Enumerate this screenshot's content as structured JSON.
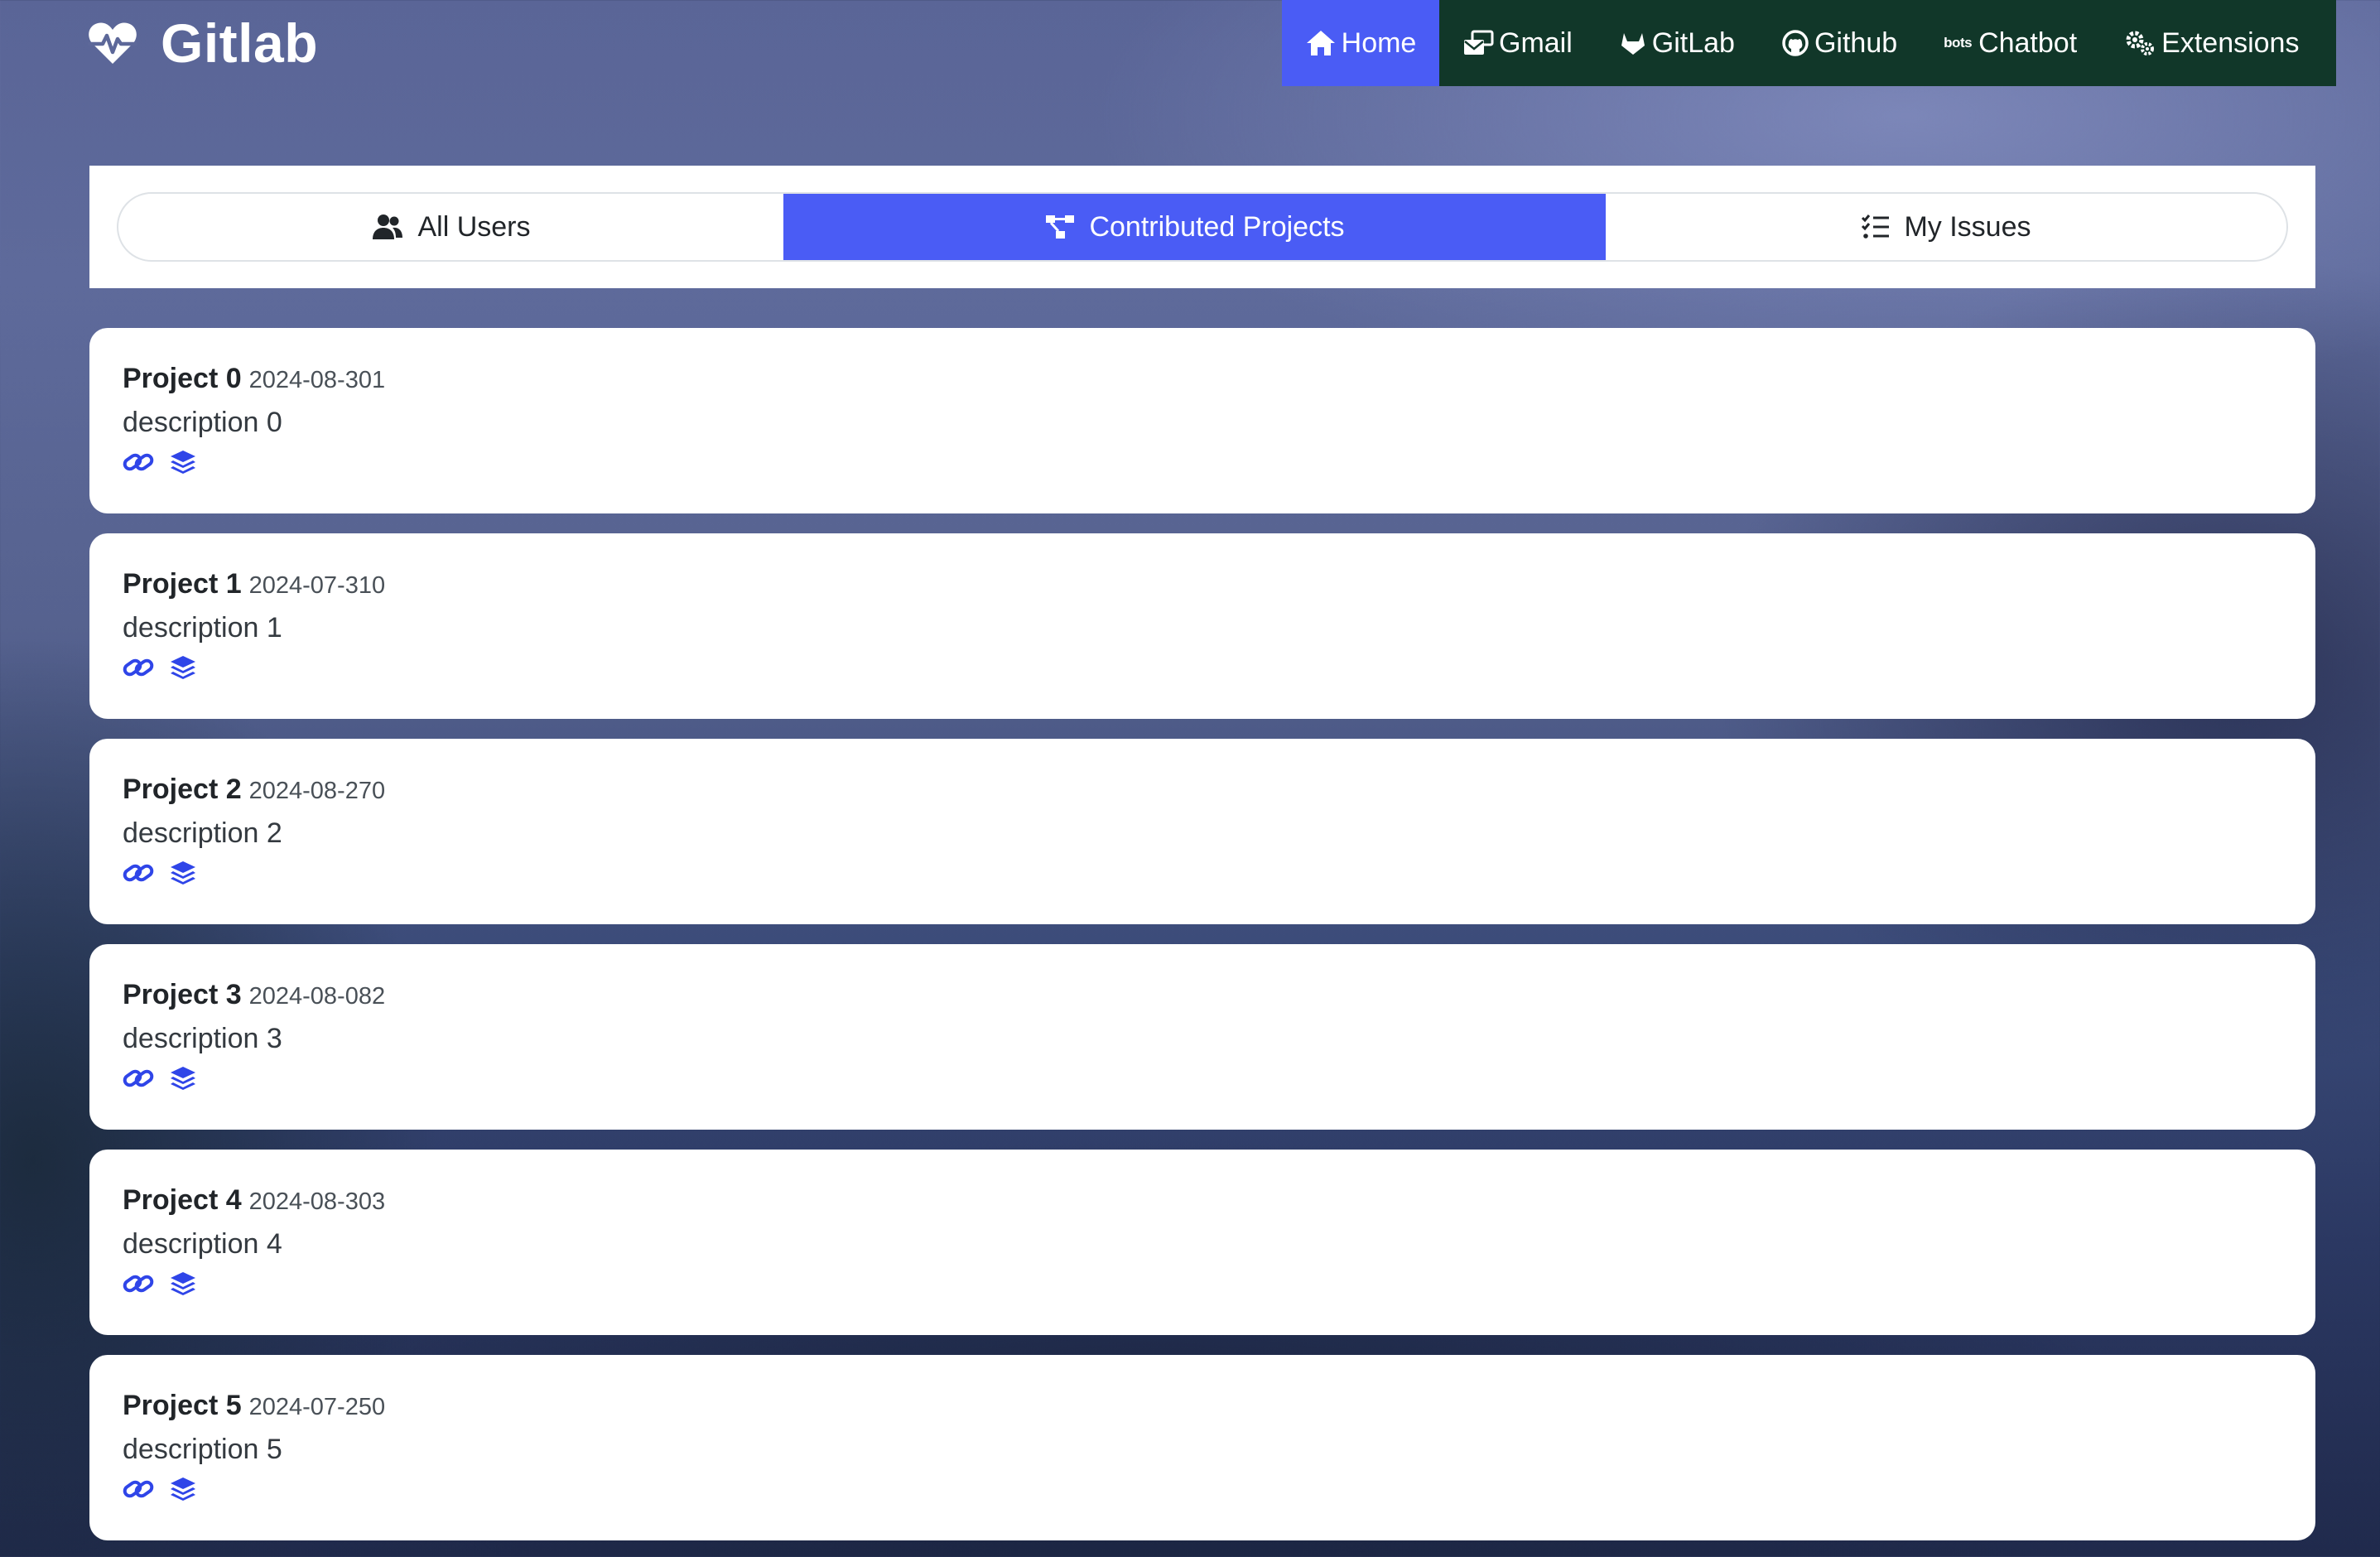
{
  "brand": {
    "title": "Gitlab",
    "icon": "heart-pulse-icon"
  },
  "nav": {
    "items": [
      {
        "label": "Home",
        "icon": "home-icon",
        "active": true
      },
      {
        "label": "Gmail",
        "icon": "mail-stack-icon"
      },
      {
        "label": "GitLab",
        "icon": "gitlab-icon"
      },
      {
        "label": "Github",
        "icon": "github-icon"
      },
      {
        "label": "Chatbot",
        "icon": "bots-icon",
        "glyph": "bots"
      },
      {
        "label": "Extensions",
        "icon": "gears-icon"
      }
    ],
    "colors": {
      "background": "#113729",
      "active": "#4a5cf5"
    }
  },
  "tabs": {
    "items": [
      {
        "label": "All Users",
        "icon": "users-icon"
      },
      {
        "label": "Contributed Projects",
        "icon": "project-diagram-icon",
        "active": true
      },
      {
        "label": "My Issues",
        "icon": "tasks-list-icon"
      }
    ]
  },
  "projects": [
    {
      "title": "Project 0",
      "date": "2024-08-301",
      "description": "description 0"
    },
    {
      "title": "Project 1",
      "date": "2024-07-310",
      "description": "description 1"
    },
    {
      "title": "Project 2",
      "date": "2024-08-270",
      "description": "description 2"
    },
    {
      "title": "Project 3",
      "date": "2024-08-082",
      "description": "description 3"
    },
    {
      "title": "Project 4",
      "date": "2024-08-303",
      "description": "description 4"
    },
    {
      "title": "Project 5",
      "date": "2024-07-250",
      "description": "description 5"
    }
  ],
  "card_icons": {
    "link": "link-icon",
    "layers": "layers-icon",
    "color": "#2f45e8"
  }
}
